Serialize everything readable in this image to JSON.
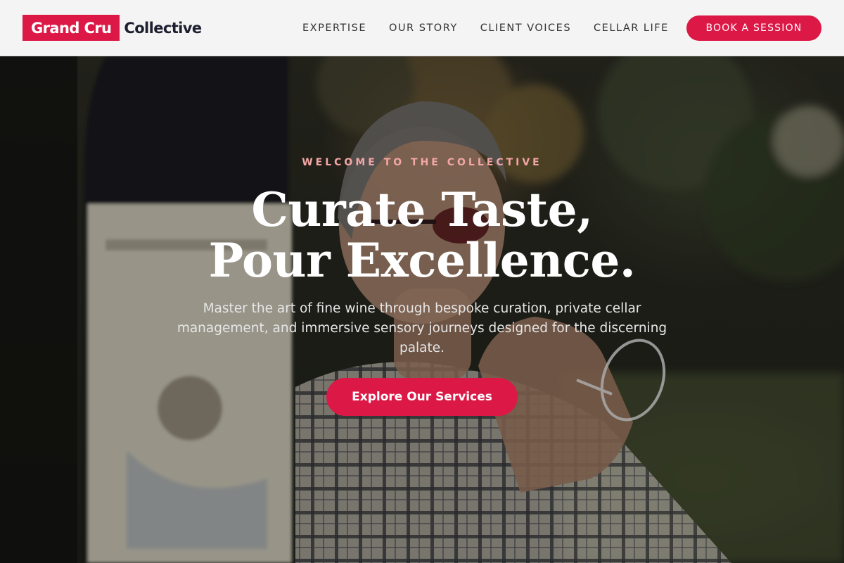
{
  "header": {
    "logo_badge": "Grand Cru",
    "logo_text": "Collective",
    "nav": [
      {
        "label": "EXPERTISE"
      },
      {
        "label": "OUR STORY"
      },
      {
        "label": "CLIENT VOICES"
      },
      {
        "label": "CELLAR LIFE"
      }
    ],
    "cta_label": "BOOK A SESSION"
  },
  "hero": {
    "eyebrow": "WELCOME TO THE COLLECTIVE",
    "headline_line1": "Curate Taste,",
    "headline_line2": "Pour Excellence.",
    "subtext": "Master the art of fine wine through bespoke curation, private cellar management, and immersive sensory journeys designed for the discerning palate.",
    "cta_label": "Explore Our Services"
  },
  "colors": {
    "accent": "#dc1846",
    "header_bg": "#f4f4f4",
    "logo_text": "#1c1f2e",
    "eyebrow": "#f2a6a6"
  }
}
